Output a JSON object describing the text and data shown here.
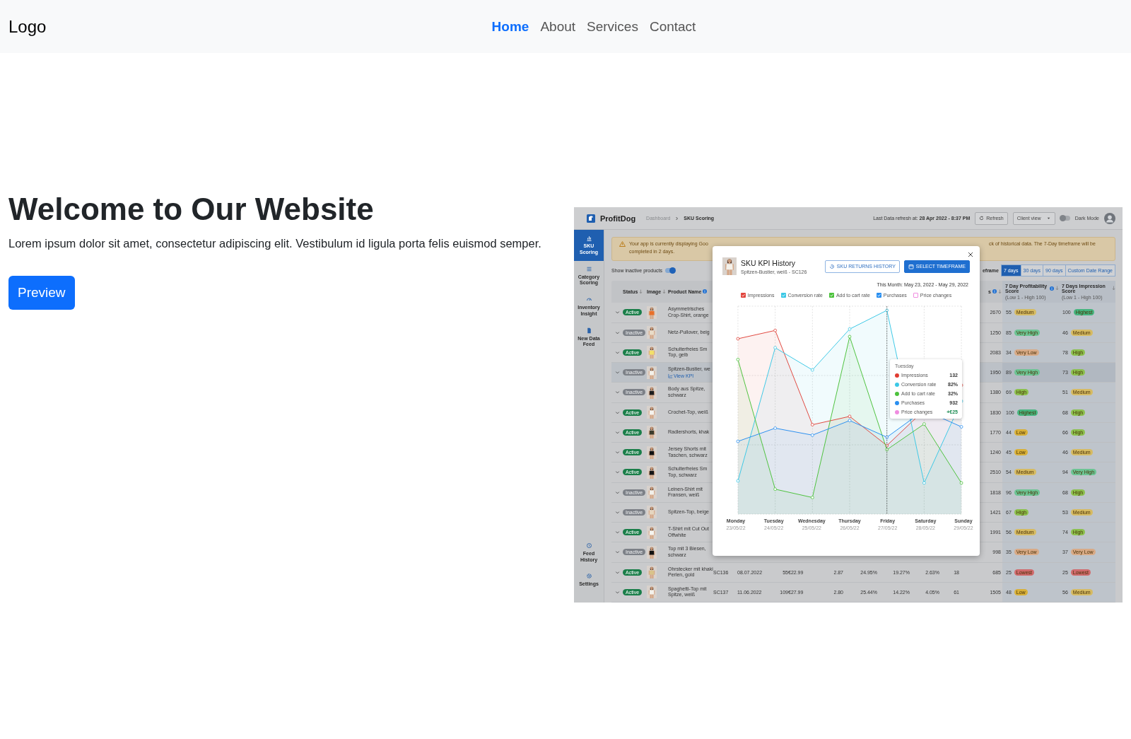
{
  "navbar": {
    "logo": "Logo",
    "links": [
      {
        "label": "Home",
        "selected": true
      },
      {
        "label": "About",
        "selected": false
      },
      {
        "label": "Services",
        "selected": false
      },
      {
        "label": "Contact",
        "selected": false
      }
    ]
  },
  "hero": {
    "title": "Welcome to Our Website",
    "text": "Lorem ipsum dolor sit amet, consectetur adipiscing elit. Vestibulum id ligula porta felis euismod semper.",
    "button": "Preview"
  },
  "preview": {
    "brand": "ProfitDog",
    "breadcrumb": [
      "Dashboard",
      "SKU Scoring"
    ],
    "refresh_info": "Last Data refresh at: **28 Apr 2022 - 8:37 PM**",
    "refresh_button": "Refresh",
    "view_select": "Client view",
    "dark_mode": {
      "label": "Dark Mode",
      "on": false
    },
    "sidebar": {
      "items": [
        {
          "label": "SKU Scoring",
          "selected": true
        },
        {
          "label": "Category Scoring",
          "selected": false
        },
        {
          "label": "Inventory Insight",
          "selected": false
        },
        {
          "label": "New Data Feed",
          "selected": false
        }
      ],
      "bottom_items": [
        {
          "label": "Feed History",
          "selected": false
        },
        {
          "label": "Settings",
          "selected": false
        }
      ]
    },
    "banner": {
      "lines_left": [
        "Your app is currently displaying Goo",
        "completed in 2 days."
      ],
      "line_right": "ck of historical data. The 7-Day timeframe will be"
    },
    "inactive_toggle": {
      "label": "Show inactive products",
      "on": true
    },
    "timeframe": {
      "label": "eframe",
      "options": [
        {
          "label": "7 days",
          "selected": true
        },
        {
          "label": "30 days",
          "selected": false
        },
        {
          "label": "90 days",
          "selected": false
        },
        {
          "label": "Custom Date Range",
          "selected": false
        }
      ]
    },
    "table": {
      "columns": [
        {
          "label": "Status",
          "sort": true,
          "info": false
        },
        {
          "label": "Image",
          "sort": true,
          "info": false
        },
        {
          "label": "Product Name",
          "sort": false,
          "info": true
        },
        {
          "label": "s",
          "sort": true,
          "info": true
        },
        {
          "label": "7 Day Profitability Score",
          "sort": true,
          "info": true,
          "subtitle": "(Low 1 - High 100)"
        },
        {
          "label": "7 Days Impression Score",
          "sort": true,
          "info": false,
          "subtitle": "(Low 1 - High 100)"
        }
      ],
      "rows": [
        {
          "status": "Active",
          "active": true,
          "selected": false,
          "product": "Asymmetrisches Crop-Shirt, orange",
          "count": "2670",
          "profitability": {
            "score": "55",
            "label": "Medium",
            "color": "#d6bb63"
          },
          "impression": {
            "score": "100",
            "label": "Highest",
            "color": "#46b57f"
          }
        },
        {
          "status": "Inactive",
          "active": false,
          "selected": false,
          "product": "Netz-Pullover, beig",
          "count": "1250",
          "profitability": {
            "score": "85",
            "label": "Very High",
            "color": "#6cc493"
          },
          "impression": {
            "score": "46",
            "label": "Medium",
            "color": "#d6bb63"
          }
        },
        {
          "status": "Active",
          "active": true,
          "selected": false,
          "product": "Schulterfreies Sm Top, gelb",
          "count": "2083",
          "profitability": {
            "score": "34",
            "label": "Very Low",
            "color": "#d8aa86"
          },
          "impression": {
            "score": "78",
            "label": "High",
            "color": "#8cc04d"
          }
        },
        {
          "status": "Inactive",
          "active": false,
          "selected": true,
          "product": "Spitzen-Bustier, we",
          "link": "View KPI",
          "count": "1950",
          "profitability": {
            "score": "89",
            "label": "Very High",
            "color": "#6cc493"
          },
          "impression": {
            "score": "73",
            "label": "High",
            "color": "#8cc04d"
          }
        },
        {
          "status": "Inactive",
          "active": false,
          "selected": false,
          "product": "Body aus Spitze, schwarz",
          "count": "1380",
          "profitability": {
            "score": "69",
            "label": "High",
            "color": "#8cc04d"
          },
          "impression": {
            "score": "51",
            "label": "Medium",
            "color": "#d6bb63"
          }
        },
        {
          "status": "Active",
          "active": true,
          "selected": false,
          "product": "Crochet-Top, weiß",
          "count": "1830",
          "profitability": {
            "score": "100",
            "label": "Highest",
            "color": "#46b57f"
          },
          "impression": {
            "score": "68",
            "label": "High",
            "color": "#8cc04d"
          }
        },
        {
          "status": "Active",
          "active": true,
          "selected": false,
          "product": "Radlershorts, khak",
          "count": "1770",
          "profitability": {
            "score": "44",
            "label": "Low",
            "color": "#d8b038"
          },
          "impression": {
            "score": "66",
            "label": "High",
            "color": "#8cc04d"
          }
        },
        {
          "status": "Active",
          "active": true,
          "selected": false,
          "product": "Jersey Shorts mit Taschen, schwarz",
          "count": "1240",
          "profitability": {
            "score": "45",
            "label": "Low",
            "color": "#d8b038"
          },
          "impression": {
            "score": "46",
            "label": "Medium",
            "color": "#d6bb63"
          }
        },
        {
          "status": "Active",
          "active": true,
          "selected": false,
          "product": "Schulterfreies Sm Top, schwarz",
          "count": "2510",
          "profitability": {
            "score": "54",
            "label": "Medium",
            "color": "#d6bb63"
          },
          "impression": {
            "score": "94",
            "label": "Very High",
            "color": "#6cc493"
          }
        },
        {
          "status": "Inactive",
          "active": false,
          "selected": false,
          "product": "Leinen-Shirt mit Fransen, weiß",
          "count": "1818",
          "profitability": {
            "score": "96",
            "label": "Very High",
            "color": "#6cc493"
          },
          "impression": {
            "score": "68",
            "label": "High",
            "color": "#8cc04d"
          }
        },
        {
          "status": "Inactive",
          "active": false,
          "selected": false,
          "product": "Spitzen-Top, beige",
          "count": "1421",
          "profitability": {
            "score": "67",
            "label": "High",
            "color": "#8cc04d"
          },
          "impression": {
            "score": "53",
            "label": "Medium",
            "color": "#d6bb63"
          }
        },
        {
          "status": "Active",
          "active": true,
          "selected": false,
          "product": "T-Shirt mit Cut Out Offwhite",
          "count": "1991",
          "profitability": {
            "score": "56",
            "label": "Medium",
            "color": "#d6bb63"
          },
          "impression": {
            "score": "74",
            "label": "High",
            "color": "#8cc04d"
          }
        },
        {
          "status": "Inactive",
          "active": false,
          "selected": false,
          "product": "Top mit 3 Biesen, schwarz",
          "count": "998",
          "profitability": {
            "score": "35",
            "label": "Very Low",
            "color": "#d8aa86"
          },
          "impression": {
            "score": "37",
            "label": "Very Low",
            "color": "#d8aa86"
          }
        },
        {
          "status": "Active",
          "active": true,
          "selected": false,
          "product": "Ohrstecker mit khaki Perlen, gold",
          "details": [
            "SC136",
            "08.07.2022",
            "55",
            "€22.99",
            "2.87",
            "24.95%",
            "19.27%",
            "2.63%",
            "18"
          ],
          "count": "685",
          "profitability": {
            "score": "25",
            "label": "Lowest",
            "color": "#d06a6c"
          },
          "impression": {
            "score": "25",
            "label": "Lowest",
            "color": "#d06a6c"
          }
        },
        {
          "status": "Active",
          "active": true,
          "selected": false,
          "product": "Spaghetti-Top mit Spitze, weiß",
          "details": [
            "SC137",
            "11.06.2022",
            "109",
            "€27.99",
            "2.80",
            "25.44%",
            "14.22%",
            "4.05%",
            "61"
          ],
          "count": "1505",
          "profitability": {
            "score": "48",
            "label": "Low",
            "color": "#d8b038"
          },
          "impression": {
            "score": "56",
            "label": "Medium",
            "color": "#d6bb63"
          }
        }
      ]
    },
    "modal": {
      "title": "SKU KPI History",
      "subtitle": "Spitzen-Bustier, weiß - SC126",
      "buttons": [
        {
          "label": "SKU RETURNS HISTORY",
          "kind": "outline"
        },
        {
          "label": "SELECT TIMEFRAME",
          "kind": "primary"
        }
      ],
      "date_range": "This Month: May 23, 2022 - May 29, 2022",
      "legend": [
        {
          "label": "Impressions",
          "checked": true,
          "color": "#e0463e"
        },
        {
          "label": "Conversion rate",
          "checked": true,
          "color": "#3cc8e6"
        },
        {
          "label": "Add to cart rate",
          "checked": true,
          "color": "#4cc23c"
        },
        {
          "label": "Purchases",
          "checked": true,
          "color": "#2a8ff0"
        },
        {
          "label": "Price changes",
          "checked": false,
          "color": "#f08ce0"
        }
      ],
      "x_labels": [
        {
          "day": "Monday",
          "date": "23/05/22"
        },
        {
          "day": "Tuesday",
          "date": "24/05/22"
        },
        {
          "day": "Wednesday",
          "date": "25/05/22"
        },
        {
          "day": "Thursday",
          "date": "26/05/22"
        },
        {
          "day": "Friday",
          "date": "27/05/22"
        },
        {
          "day": "Saturday",
          "date": "28/05/22"
        },
        {
          "day": "Sunday",
          "date": "29/05/22"
        }
      ],
      "tooltip": {
        "title": "Tuesday",
        "rows": [
          {
            "label": "Impressions",
            "value": "132",
            "color": "#e03c31",
            "change": false
          },
          {
            "label": "Conversion rate",
            "value": "82%",
            "color": "#3cc8e6",
            "change": false
          },
          {
            "label": "Add to cart rate",
            "value": "32%",
            "color": "#4cc23c",
            "change": false
          },
          {
            "label": "Purchases",
            "value": "932",
            "color": "#2a8ff0",
            "change": false
          },
          {
            "label": "Price changes",
            "value": "+€25",
            "color": "#f08ce0",
            "change": true
          }
        ]
      }
    }
  }
}
